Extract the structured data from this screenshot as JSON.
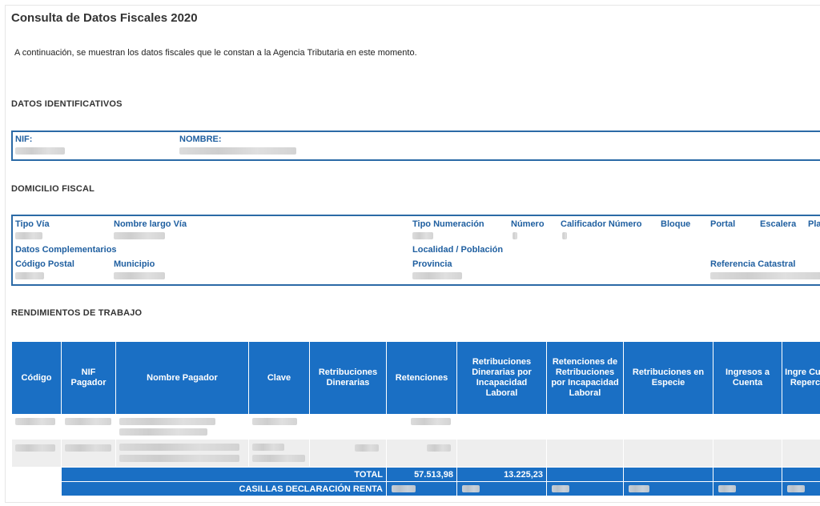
{
  "page": {
    "title": "Consulta de Datos Fiscales 2020",
    "intro": "A continuación, se muestran los datos fiscales que le constan a la Agencia Tributaria en este momento."
  },
  "identificativos": {
    "section": "DATOS IDENTIFICATIVOS",
    "nif_label": "NIF:",
    "nombre_label": "NOMBRE:"
  },
  "domicilio": {
    "section": "DOMICILIO FISCAL",
    "labels": {
      "tipo_via": "Tipo Vía",
      "nombre_via": "Nombre largo Vía",
      "tipo_numeracion": "Tipo Numeración",
      "numero": "Número",
      "calificador": "Calificador Número",
      "bloque": "Bloque",
      "portal": "Portal",
      "escalera": "Escalera",
      "planta": "Pla",
      "datos_complementarios": "Datos Complementarios",
      "localidad": "Localidad / Población",
      "codigo_postal": "Código Postal",
      "municipio": "Municipio",
      "provincia": "Provincia",
      "referencia_catastral": "Referencia Catastral"
    }
  },
  "rendimientos": {
    "section": "RENDIMIENTOS DE TRABAJO",
    "columns": [
      "Código",
      "NIF Pagador",
      "Nombre Pagador",
      "Clave",
      "Retribuciones Dinerarias",
      "Retenciones",
      "Retribuciones Dinerarias por Incapacidad Laboral",
      "Retenciones de Retribuciones por Incapacidad Laboral",
      "Retribuciones en Especie",
      "Ingresos a Cuenta",
      "Ingre Cue Reperc"
    ],
    "total_label": "TOTAL",
    "total_retribuciones": "57.513,98",
    "total_retenciones": "13.225,23",
    "casillas_label": "CASILLAS DECLARACIÓN RENTA"
  },
  "colors": {
    "accent": "#1a6fc4",
    "box_border": "#2b6aa6",
    "label_blue": "#1f5fa0"
  }
}
